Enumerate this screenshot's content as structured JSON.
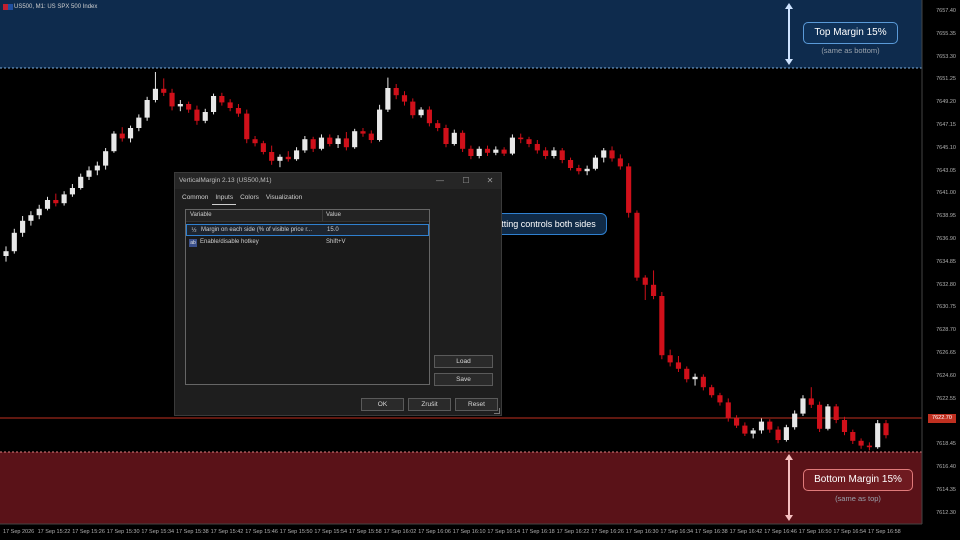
{
  "header": {
    "symbol_info": "US500, M1: US SPX 500 Index"
  },
  "colors": {
    "bull": "#e8e8e8",
    "bear": "#d0101a",
    "top_zone": "#0e2b4d",
    "bottom_zone": "#5a1218",
    "accent_blue": "#2f80d0"
  },
  "top_margin": {
    "label": "Top Margin  15%",
    "sub": "(same as bottom)"
  },
  "bottom_margin": {
    "label": "Bottom Margin  15%",
    "sub": "(same as top)"
  },
  "callout": {
    "text": "One setting controls both sides"
  },
  "dialog": {
    "title": "VerticalMargin 2.13 (US500,M1)",
    "window_buttons": {
      "minimize": "—",
      "maximize": "☐",
      "close": "✕"
    },
    "tabs": [
      "Common",
      "Inputs",
      "Colors",
      "Visualization"
    ],
    "active_tab": "Inputs",
    "table": {
      "headers": [
        "Variable",
        "Value"
      ],
      "rows": [
        {
          "icon": "½",
          "variable": "Margin on each side (% of visible price r...",
          "value": "15.0",
          "selected": true
        },
        {
          "icon": "ab",
          "variable": "Enable/disable hotkey",
          "value": "Shift+V",
          "selected": false
        }
      ]
    },
    "buttons": {
      "load": "Load",
      "save": "Save",
      "ok": "OK",
      "cancel": "Zrušit",
      "reset": "Reset"
    }
  },
  "price_axis": [
    "7657.40",
    "7655.35",
    "7653.30",
    "7651.25",
    "7649.20",
    "7647.15",
    "7645.10",
    "7643.05",
    "7641.00",
    "7638.95",
    "7636.90",
    "7634.85",
    "7632.80",
    "7630.75",
    "7628.70",
    "7626.65",
    "7624.60",
    "7622.55",
    "7620.50",
    "7618.45",
    "7616.40",
    "7614.35",
    "7612.30"
  ],
  "current_price": "7622.70",
  "time_axis": [
    "17 Sep 2026",
    "17 Sep 15:22",
    "17 Sep 15:26",
    "17 Sep 15:30",
    "17 Sep 15:34",
    "17 Sep 15:38",
    "17 Sep 15:42",
    "17 Sep 15:46",
    "17 Sep 15:50",
    "17 Sep 15:54",
    "17 Sep 15:58",
    "17 Sep 16:02",
    "17 Sep 16:06",
    "17 Sep 16:10",
    "17 Sep 16:14",
    "17 Sep 16:18",
    "17 Sep 16:22",
    "17 Sep 16:26",
    "17 Sep 16:30",
    "17 Sep 16:34",
    "17 Sep 16:38",
    "17 Sep 16:42",
    "17 Sep 16:46",
    "17 Sep 16:50",
    "17 Sep 16:54",
    "17 Sep 16:58"
  ],
  "chart_data": {
    "type": "candlestick",
    "price_min": 7612.0,
    "price_max": 7658.0,
    "candles": [
      {
        "o": 7630.0,
        "h": 7631.2,
        "l": 7629.3,
        "c": 7630.6
      },
      {
        "o": 7630.6,
        "h": 7633.4,
        "l": 7630.3,
        "c": 7632.9
      },
      {
        "o": 7632.9,
        "h": 7635.0,
        "l": 7632.4,
        "c": 7634.4
      },
      {
        "o": 7634.4,
        "h": 7635.6,
        "l": 7633.8,
        "c": 7635.1
      },
      {
        "o": 7635.1,
        "h": 7636.4,
        "l": 7634.6,
        "c": 7635.9
      },
      {
        "o": 7635.9,
        "h": 7637.4,
        "l": 7635.7,
        "c": 7637.0
      },
      {
        "o": 7637.0,
        "h": 7637.8,
        "l": 7636.2,
        "c": 7636.6
      },
      {
        "o": 7636.6,
        "h": 7638.1,
        "l": 7636.3,
        "c": 7637.7
      },
      {
        "o": 7637.7,
        "h": 7639.0,
        "l": 7637.4,
        "c": 7638.5
      },
      {
        "o": 7638.5,
        "h": 7640.3,
        "l": 7638.3,
        "c": 7639.9
      },
      {
        "o": 7639.9,
        "h": 7641.2,
        "l": 7639.5,
        "c": 7640.7
      },
      {
        "o": 7640.7,
        "h": 7641.8,
        "l": 7640.1,
        "c": 7641.3
      },
      {
        "o": 7641.3,
        "h": 7643.5,
        "l": 7640.8,
        "c": 7643.1
      },
      {
        "o": 7643.1,
        "h": 7645.6,
        "l": 7642.9,
        "c": 7645.3
      },
      {
        "o": 7645.3,
        "h": 7646.1,
        "l": 7644.3,
        "c": 7644.7
      },
      {
        "o": 7644.7,
        "h": 7646.3,
        "l": 7644.2,
        "c": 7646.0
      },
      {
        "o": 7646.0,
        "h": 7647.7,
        "l": 7645.6,
        "c": 7647.3
      },
      {
        "o": 7647.3,
        "h": 7649.9,
        "l": 7646.9,
        "c": 7649.5
      },
      {
        "o": 7649.5,
        "h": 7653.0,
        "l": 7649.2,
        "c": 7650.9
      },
      {
        "o": 7650.9,
        "h": 7652.2,
        "l": 7650.0,
        "c": 7650.4
      },
      {
        "o": 7650.4,
        "h": 7650.9,
        "l": 7648.2,
        "c": 7648.7
      },
      {
        "o": 7648.7,
        "h": 7649.5,
        "l": 7648.1,
        "c": 7649.0
      },
      {
        "o": 7649.0,
        "h": 7649.3,
        "l": 7647.9,
        "c": 7648.3
      },
      {
        "o": 7648.3,
        "h": 7648.8,
        "l": 7646.4,
        "c": 7646.9
      },
      {
        "o": 7646.9,
        "h": 7648.4,
        "l": 7646.6,
        "c": 7648.0
      },
      {
        "o": 7648.0,
        "h": 7650.3,
        "l": 7647.7,
        "c": 7650.0
      },
      {
        "o": 7650.0,
        "h": 7650.4,
        "l": 7648.8,
        "c": 7649.2
      },
      {
        "o": 7649.2,
        "h": 7649.6,
        "l": 7648.1,
        "c": 7648.5
      },
      {
        "o": 7648.5,
        "h": 7649.0,
        "l": 7647.4,
        "c": 7647.8
      },
      {
        "o": 7647.8,
        "h": 7648.3,
        "l": 7644.1,
        "c": 7644.6
      },
      {
        "o": 7644.6,
        "h": 7645.0,
        "l": 7643.7,
        "c": 7644.1
      },
      {
        "o": 7644.1,
        "h": 7644.4,
        "l": 7642.7,
        "c": 7643.0
      },
      {
        "o": 7643.0,
        "h": 7643.8,
        "l": 7641.4,
        "c": 7641.9
      },
      {
        "o": 7641.9,
        "h": 7642.7,
        "l": 7641.1,
        "c": 7642.4
      },
      {
        "o": 7642.4,
        "h": 7643.1,
        "l": 7641.8,
        "c": 7642.1
      },
      {
        "o": 7642.1,
        "h": 7643.6,
        "l": 7641.9,
        "c": 7643.2
      },
      {
        "o": 7643.2,
        "h": 7645.0,
        "l": 7642.9,
        "c": 7644.6
      },
      {
        "o": 7644.6,
        "h": 7644.9,
        "l": 7643.0,
        "c": 7643.4
      },
      {
        "o": 7643.4,
        "h": 7645.2,
        "l": 7643.2,
        "c": 7644.8
      },
      {
        "o": 7644.8,
        "h": 7645.2,
        "l": 7643.7,
        "c": 7644.0
      },
      {
        "o": 7644.0,
        "h": 7645.1,
        "l": 7643.5,
        "c": 7644.7
      },
      {
        "o": 7644.7,
        "h": 7645.5,
        "l": 7643.2,
        "c": 7643.6
      },
      {
        "o": 7643.6,
        "h": 7645.9,
        "l": 7643.4,
        "c": 7645.6
      },
      {
        "o": 7645.6,
        "h": 7646.0,
        "l": 7644.9,
        "c": 7645.3
      },
      {
        "o": 7645.3,
        "h": 7645.7,
        "l": 7644.1,
        "c": 7644.5
      },
      {
        "o": 7644.5,
        "h": 7648.9,
        "l": 7644.3,
        "c": 7648.3
      },
      {
        "o": 7648.3,
        "h": 7652.3,
        "l": 7648.0,
        "c": 7651.0
      },
      {
        "o": 7651.0,
        "h": 7651.5,
        "l": 7649.6,
        "c": 7650.1
      },
      {
        "o": 7650.1,
        "h": 7650.6,
        "l": 7648.8,
        "c": 7649.3
      },
      {
        "o": 7649.3,
        "h": 7649.7,
        "l": 7647.2,
        "c": 7647.6
      },
      {
        "o": 7647.6,
        "h": 7648.6,
        "l": 7647.3,
        "c": 7648.3
      },
      {
        "o": 7648.3,
        "h": 7648.7,
        "l": 7646.2,
        "c": 7646.6
      },
      {
        "o": 7646.6,
        "h": 7647.0,
        "l": 7645.6,
        "c": 7646.0
      },
      {
        "o": 7646.0,
        "h": 7646.4,
        "l": 7643.6,
        "c": 7644.0
      },
      {
        "o": 7644.0,
        "h": 7645.8,
        "l": 7643.8,
        "c": 7645.4
      },
      {
        "o": 7645.4,
        "h": 7645.7,
        "l": 7643.0,
        "c": 7643.4
      },
      {
        "o": 7643.4,
        "h": 7643.8,
        "l": 7642.1,
        "c": 7642.5
      },
      {
        "o": 7642.5,
        "h": 7643.7,
        "l": 7642.2,
        "c": 7643.4
      },
      {
        "o": 7643.4,
        "h": 7643.8,
        "l": 7642.5,
        "c": 7642.9
      },
      {
        "o": 7642.9,
        "h": 7643.7,
        "l": 7642.6,
        "c": 7643.3
      },
      {
        "o": 7643.3,
        "h": 7643.6,
        "l": 7642.5,
        "c": 7642.8
      },
      {
        "o": 7642.8,
        "h": 7645.2,
        "l": 7642.6,
        "c": 7644.8
      },
      {
        "o": 7644.8,
        "h": 7645.3,
        "l": 7644.1,
        "c": 7644.6
      },
      {
        "o": 7644.6,
        "h": 7644.9,
        "l": 7643.6,
        "c": 7644.0
      },
      {
        "o": 7644.0,
        "h": 7644.5,
        "l": 7642.8,
        "c": 7643.2
      },
      {
        "o": 7643.2,
        "h": 7643.6,
        "l": 7642.1,
        "c": 7642.5
      },
      {
        "o": 7642.5,
        "h": 7643.6,
        "l": 7642.2,
        "c": 7643.2
      },
      {
        "o": 7643.2,
        "h": 7643.5,
        "l": 7641.6,
        "c": 7642.0
      },
      {
        "o": 7642.0,
        "h": 7642.3,
        "l": 7640.7,
        "c": 7641.0
      },
      {
        "o": 7641.0,
        "h": 7641.4,
        "l": 7640.2,
        "c": 7640.6
      },
      {
        "o": 7640.6,
        "h": 7641.3,
        "l": 7640.1,
        "c": 7640.9
      },
      {
        "o": 7640.9,
        "h": 7642.6,
        "l": 7640.7,
        "c": 7642.3
      },
      {
        "o": 7642.3,
        "h": 7643.5,
        "l": 7641.7,
        "c": 7643.2
      },
      {
        "o": 7643.2,
        "h": 7643.7,
        "l": 7641.8,
        "c": 7642.2
      },
      {
        "o": 7642.2,
        "h": 7642.7,
        "l": 7640.8,
        "c": 7641.2
      },
      {
        "o": 7641.2,
        "h": 7641.6,
        "l": 7634.8,
        "c": 7635.4
      },
      {
        "o": 7635.4,
        "h": 7635.7,
        "l": 7626.9,
        "c": 7627.3
      },
      {
        "o": 7627.3,
        "h": 7627.6,
        "l": 7624.5,
        "c": 7626.4
      },
      {
        "o": 7626.4,
        "h": 7628.2,
        "l": 7624.6,
        "c": 7625.0
      },
      {
        "o": 7625.0,
        "h": 7625.5,
        "l": 7617.1,
        "c": 7617.6
      },
      {
        "o": 7617.6,
        "h": 7618.3,
        "l": 7616.2,
        "c": 7616.7
      },
      {
        "o": 7616.7,
        "h": 7617.5,
        "l": 7615.5,
        "c": 7615.9
      },
      {
        "o": 7615.9,
        "h": 7616.2,
        "l": 7614.2,
        "c": 7614.6
      },
      {
        "o": 7614.6,
        "h": 7615.3,
        "l": 7613.8,
        "c": 7614.9
      },
      {
        "o": 7614.9,
        "h": 7615.2,
        "l": 7613.2,
        "c": 7613.6
      },
      {
        "o": 7613.6,
        "h": 7613.9,
        "l": 7612.3,
        "c": 7612.6
      },
      {
        "o": 7612.6,
        "h": 7612.9,
        "l": 7611.3,
        "c": 7611.7
      },
      {
        "o": 7611.7,
        "h": 7612.2,
        "l": 7609.3,
        "c": 7609.7
      },
      {
        "o": 7609.7,
        "h": 7610.1,
        "l": 7608.5,
        "c": 7608.8
      },
      {
        "o": 7608.8,
        "h": 7609.2,
        "l": 7607.5,
        "c": 7607.8
      },
      {
        "o": 7607.8,
        "h": 7608.5,
        "l": 7607.2,
        "c": 7608.2
      },
      {
        "o": 7608.2,
        "h": 7609.7,
        "l": 7607.8,
        "c": 7609.3
      },
      {
        "o": 7609.3,
        "h": 7609.6,
        "l": 7607.9,
        "c": 7608.3
      },
      {
        "o": 7608.3,
        "h": 7608.7,
        "l": 7606.6,
        "c": 7607.0
      },
      {
        "o": 7607.0,
        "h": 7608.9,
        "l": 7606.8,
        "c": 7608.6
      },
      {
        "o": 7608.6,
        "h": 7610.7,
        "l": 7608.3,
        "c": 7610.3
      },
      {
        "o": 7610.3,
        "h": 7612.6,
        "l": 7610.0,
        "c": 7612.2
      },
      {
        "o": 7612.2,
        "h": 7613.6,
        "l": 7611.0,
        "c": 7611.4
      },
      {
        "o": 7611.4,
        "h": 7611.8,
        "l": 7608.0,
        "c": 7608.4
      },
      {
        "o": 7608.4,
        "h": 7611.5,
        "l": 7608.2,
        "c": 7611.2
      },
      {
        "o": 7611.2,
        "h": 7611.5,
        "l": 7609.1,
        "c": 7609.5
      },
      {
        "o": 7609.5,
        "h": 7609.9,
        "l": 7607.6,
        "c": 7608.0
      },
      {
        "o": 7608.0,
        "h": 7608.3,
        "l": 7606.5,
        "c": 7606.9
      },
      {
        "o": 7606.9,
        "h": 7607.2,
        "l": 7605.9,
        "c": 7606.3
      },
      {
        "o": 7606.3,
        "h": 7606.7,
        "l": 7605.7,
        "c": 7606.1
      },
      {
        "o": 7606.1,
        "h": 7609.5,
        "l": 7605.9,
        "c": 7609.1
      },
      {
        "o": 7609.1,
        "h": 7609.5,
        "l": 7607.2,
        "c": 7607.6
      }
    ]
  }
}
